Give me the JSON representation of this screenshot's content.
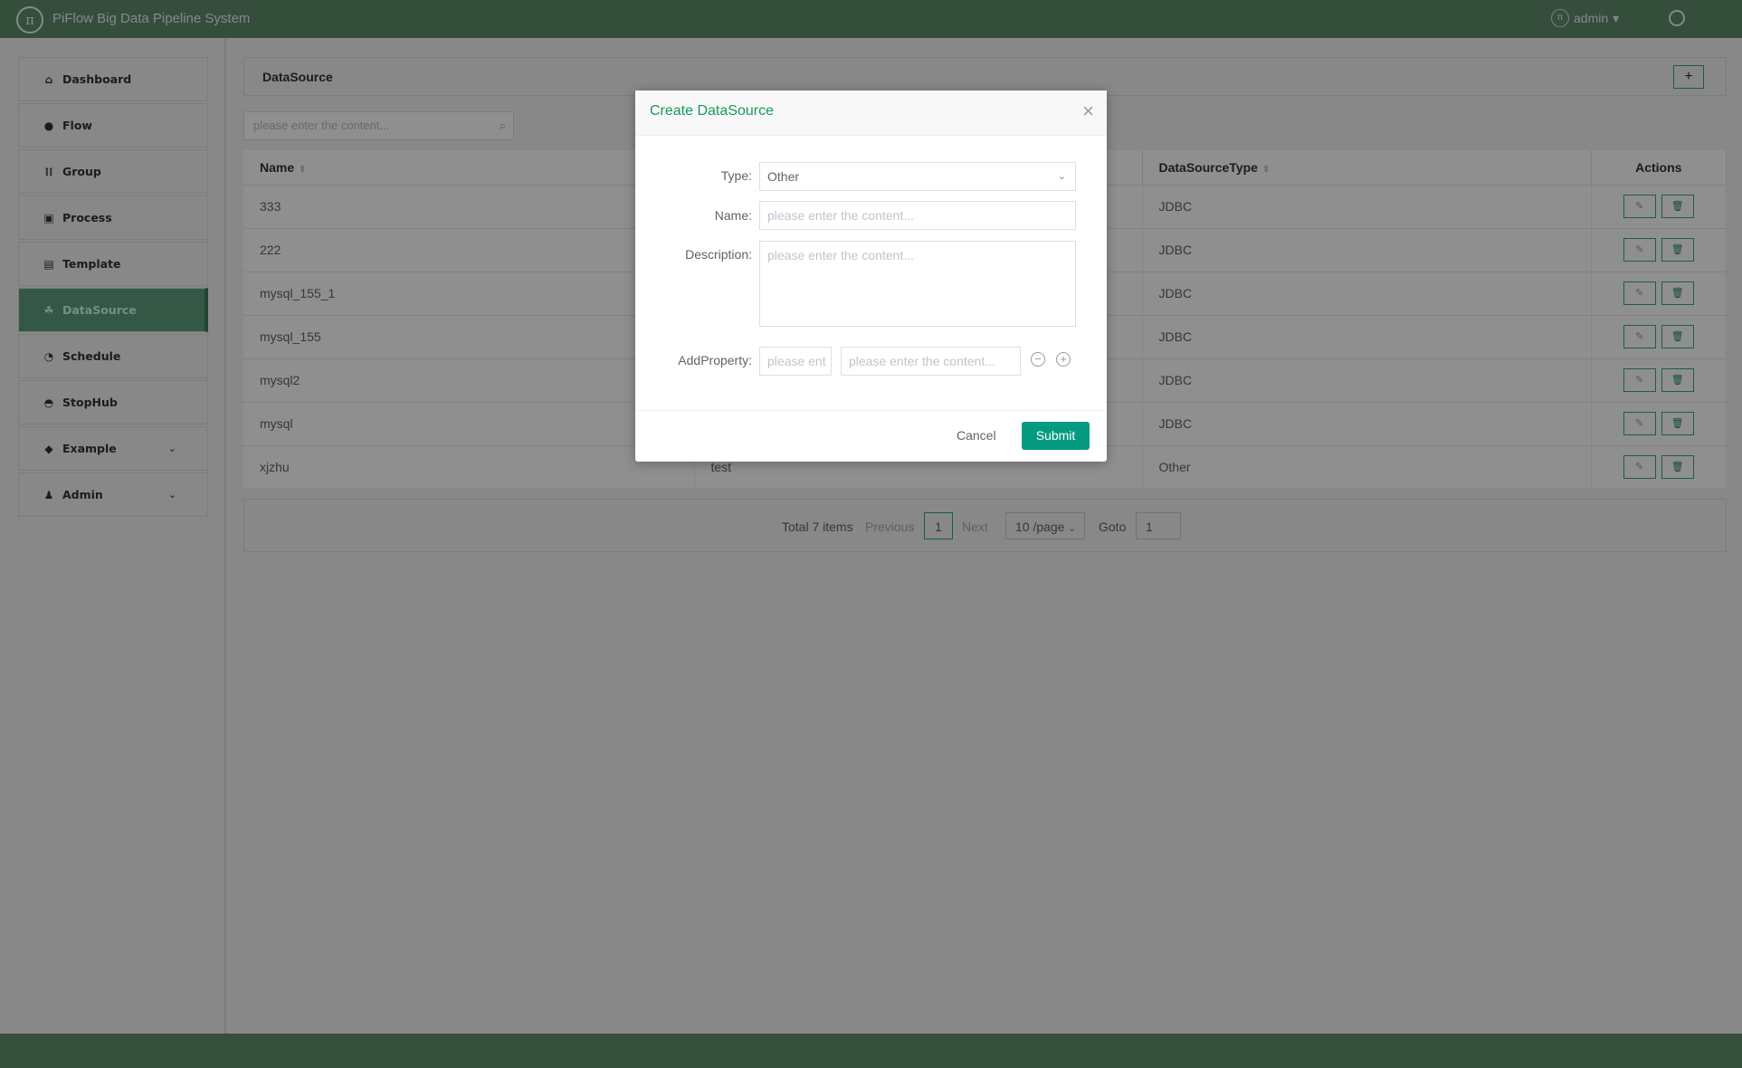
{
  "app": {
    "title": "PiFlow Big Data Pipeline System",
    "user": "admin",
    "logo_text": "π"
  },
  "sidebar": {
    "items": [
      {
        "label": "Dashboard",
        "icon": "home-icon",
        "glyph": "⌂"
      },
      {
        "label": "Flow",
        "icon": "flow-icon",
        "glyph": "●"
      },
      {
        "label": "Group",
        "icon": "grid-icon",
        "glyph": "⁞⁞"
      },
      {
        "label": "Process",
        "icon": "chart-icon",
        "glyph": "▣"
      },
      {
        "label": "Template",
        "icon": "document-icon",
        "glyph": "▤"
      },
      {
        "label": "DataSource",
        "icon": "datasource-icon",
        "glyph": "☘",
        "active": true
      },
      {
        "label": "Schedule",
        "icon": "clock-icon",
        "glyph": "◔"
      },
      {
        "label": "StopHub",
        "icon": "gauge-icon",
        "glyph": "◓"
      },
      {
        "label": "Example",
        "icon": "cube-icon",
        "glyph": "◆",
        "chevron": "⌄"
      },
      {
        "label": "Admin",
        "icon": "users-icon",
        "glyph": "♟",
        "chevron": "⌄"
      }
    ]
  },
  "page": {
    "title": "DataSource",
    "add_label": "+",
    "search_placeholder": "please enter the content..."
  },
  "table": {
    "headers": {
      "name": "Name",
      "type": "DataSourceType",
      "actions": "Actions"
    },
    "rows": [
      {
        "name": "333",
        "description": "",
        "type": "JDBC"
      },
      {
        "name": "222",
        "description": "",
        "type": "JDBC"
      },
      {
        "name": "mysql_155_1",
        "description": "",
        "type": "JDBC"
      },
      {
        "name": "mysql_155",
        "description": "",
        "type": "JDBC"
      },
      {
        "name": "mysql2",
        "description": "",
        "type": "JDBC"
      },
      {
        "name": "mysql",
        "description": "",
        "type": "JDBC"
      },
      {
        "name": "xjzhu",
        "description": "test",
        "type": "Other"
      }
    ]
  },
  "pagination": {
    "total": "Total 7 items",
    "previous": "Previous",
    "page": "1",
    "next": "Next",
    "page_size": "10 /page",
    "goto_label": "Goto",
    "goto_value": "1"
  },
  "modal": {
    "title": "Create DataSource",
    "type_label": "Type:",
    "type_value": "Other",
    "name_label": "Name:",
    "name_placeholder": "please enter the content...",
    "description_label": "Description:",
    "description_placeholder": "please enter the content...",
    "property_label": "AddProperty:",
    "property_key_placeholder": "please ent",
    "property_value_placeholder": "please enter the content...",
    "cancel": "Cancel",
    "submit": "Submit"
  },
  "colors": {
    "header": "#5f8c6b",
    "accent": "#049a82",
    "modal_title": "#19995a"
  }
}
